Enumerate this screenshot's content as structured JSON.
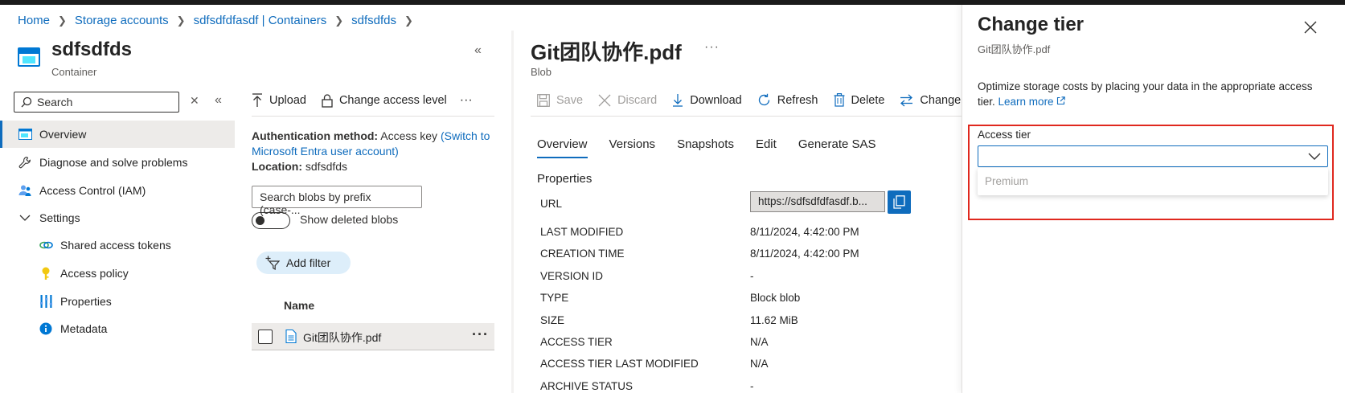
{
  "breadcrumb": {
    "items": [
      "Home",
      "Storage accounts",
      "sdfsdfdfasdf | Containers",
      "sdfsdfds"
    ]
  },
  "container": {
    "title": "sdfsdfds",
    "subtitle": "Container"
  },
  "sidebar": {
    "search_placeholder": "Search",
    "items": [
      {
        "label": "Overview",
        "icon": "container-icon",
        "active": true
      },
      {
        "label": "Diagnose and solve problems",
        "icon": "wrench-icon"
      },
      {
        "label": "Access Control (IAM)",
        "icon": "people-icon"
      },
      {
        "label": "Settings",
        "icon": "chevron-down-icon"
      },
      {
        "label": "Shared access tokens",
        "icon": "link-icon"
      },
      {
        "label": "Access policy",
        "icon": "key-icon"
      },
      {
        "label": "Properties",
        "icon": "properties-icon"
      },
      {
        "label": "Metadata",
        "icon": "info-icon"
      }
    ]
  },
  "middle": {
    "toolbar": {
      "upload": "Upload",
      "change_access": "Change access level",
      "more": "···"
    },
    "auth_label": "Authentication method:",
    "auth_value": "Access key",
    "auth_link": "(Switch to Microsoft Entra user account)",
    "location_label": "Location:",
    "location_value": "sdfsdfds",
    "search_blobs_placeholder": "Search blobs by prefix (case-...",
    "show_deleted": "Show deleted blobs",
    "add_filter": "Add filter",
    "col_name": "Name",
    "rows": [
      {
        "name": "Git团队协作.pdf"
      }
    ],
    "row_more": "···"
  },
  "blob": {
    "title": "Git团队协作.pdf",
    "more": "···",
    "subtitle": "Blob",
    "toolbar": {
      "save": "Save",
      "discard": "Discard",
      "download": "Download",
      "refresh": "Refresh",
      "delete": "Delete",
      "change": "Change"
    },
    "tabs": [
      "Overview",
      "Versions",
      "Snapshots",
      "Edit",
      "Generate SAS"
    ],
    "properties_heading": "Properties",
    "url_label": "URL",
    "url_value": "https://sdfsdfdfasdf.b...",
    "properties": [
      {
        "key": "LAST MODIFIED",
        "value": "8/11/2024, 4:42:00 PM"
      },
      {
        "key": "CREATION TIME",
        "value": "8/11/2024, 4:42:00 PM"
      },
      {
        "key": "VERSION ID",
        "value": "-"
      },
      {
        "key": "TYPE",
        "value": "Block blob"
      },
      {
        "key": "SIZE",
        "value": "11.62 MiB"
      },
      {
        "key": "ACCESS TIER",
        "value": "N/A"
      },
      {
        "key": "ACCESS TIER LAST MODIFIED",
        "value": "N/A"
      },
      {
        "key": "ARCHIVE STATUS",
        "value": "-"
      }
    ]
  },
  "tier": {
    "title": "Change tier",
    "subtitle": "Git团队协作.pdf",
    "description": "Optimize storage costs by placing your data in the appropriate access tier.",
    "learn_more": "Learn more",
    "field_label": "Access tier",
    "selected_value": "",
    "options": [
      "Premium"
    ]
  },
  "colors": {
    "accent": "#0f6cbd",
    "highlight_box": "#e0281e"
  }
}
